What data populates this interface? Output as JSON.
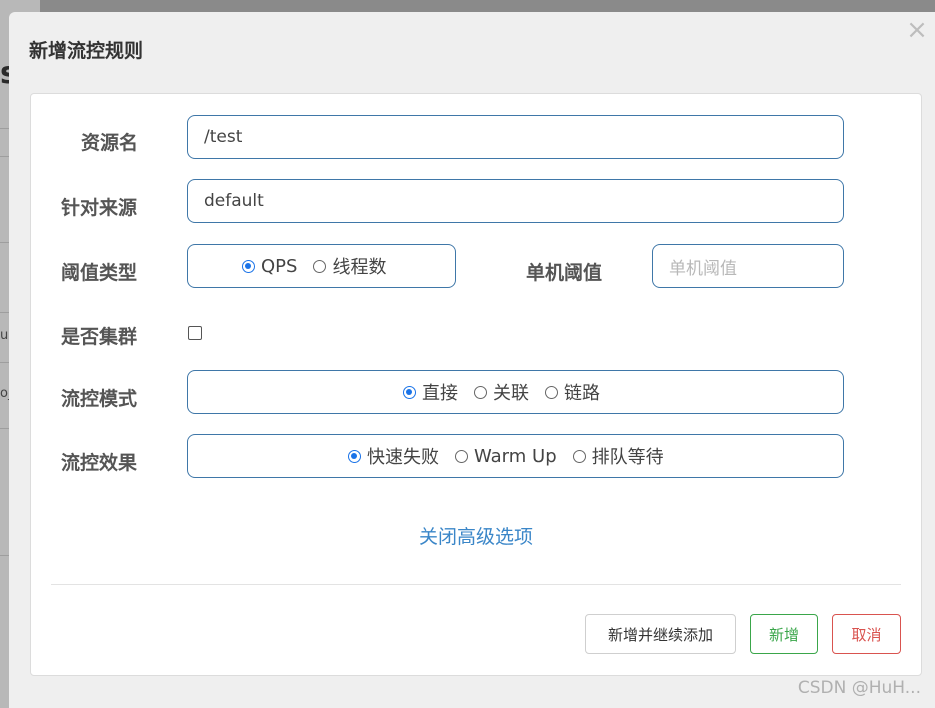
{
  "background": {
    "fragments": [
      "s",
      "u",
      "o_"
    ]
  },
  "dialog": {
    "title": "新增流控规则",
    "close_glyph": "×"
  },
  "form": {
    "resource_label": "资源名",
    "resource_value": "/test",
    "source_label": "针对来源",
    "source_value": "default",
    "threshold_type_label": "阈值类型",
    "threshold_type_options": [
      "QPS",
      "线程数"
    ],
    "threshold_type_selected": "QPS",
    "single_threshold_label": "单机阈值",
    "single_threshold_placeholder": "单机阈值",
    "cluster_label": "是否集群",
    "cluster_checked": false,
    "mode_label": "流控模式",
    "mode_options": [
      "直接",
      "关联",
      "链路"
    ],
    "mode_selected": "直接",
    "effect_label": "流控效果",
    "effect_options": [
      "快速失败",
      "Warm Up",
      "排队等待"
    ],
    "effect_selected": "快速失败"
  },
  "advanced_toggle_label": "关闭高级选项",
  "footer": {
    "add_continue_label": "新增并继续添加",
    "add_label": "新增",
    "cancel_label": "取消"
  },
  "watermark": "CSDN @HuH...",
  "colors": {
    "accent_blue": "#1a73e8",
    "link_blue": "#3a86c8",
    "success_green": "#3aa64a",
    "danger_red": "#d9534f",
    "input_border": "#3f77a8"
  }
}
